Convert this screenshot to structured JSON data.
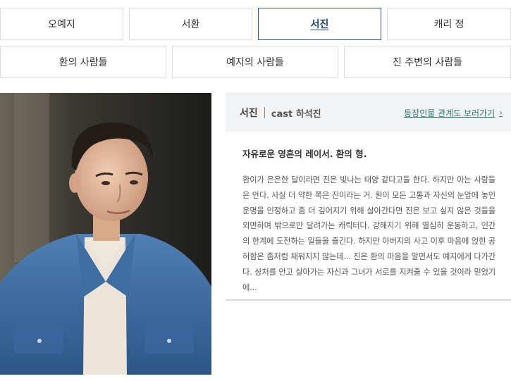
{
  "tabs_row1": [
    {
      "label": "오예지"
    },
    {
      "label": "서환"
    },
    {
      "label": "서진"
    },
    {
      "label": "캐리 정"
    }
  ],
  "tabs_row2": [
    {
      "label": "환의 사람들"
    },
    {
      "label": "예지의 사람들"
    },
    {
      "label": "진 주변의 사람들"
    }
  ],
  "active_tab": "서진",
  "profile": {
    "name": "서진",
    "cast_label": "cast",
    "actor": "하석진",
    "relation_link": "등장인물 관계도 보러가기",
    "tagline": "자유로운 영혼의 레이서. 환의 형.",
    "description": "환이가 은은한 달이라면 진은 빛나는 태양 같다고들 한다. 하지만 아는 사람들은 안다. 사실 더 약한 쪽은 진이라는 거. 환이 모든 고통과 자신의 눈앞에 놓인 운명을 인정하고 좀 더 깊어지기 위해 살아간다면 진은 보고 싶지 않은 것들을 외면하며 밖으로만 달려가는 캐릭터다. 강해지기 위해 열심히 운동하고, 인간의 한계에 도전하는 일들을 즐긴다. 하지만 아버지의 사고 이후 마음에 얹힌 공허함은 좀처럼 채워지지 않는데... 진은 환의 마음을 알면서도 예지에게 다가간다. 상처를 안고 살아가는 자신과 그녀가 서로를 지켜줄 수 있을 것이라 믿었기에..."
  },
  "colors": {
    "active_border": "#2f4e85",
    "link": "#2d7a6f",
    "panel_header_bg": "#f1f3f4"
  },
  "icons": {
    "link_chevron": "chevron-right-icon"
  }
}
